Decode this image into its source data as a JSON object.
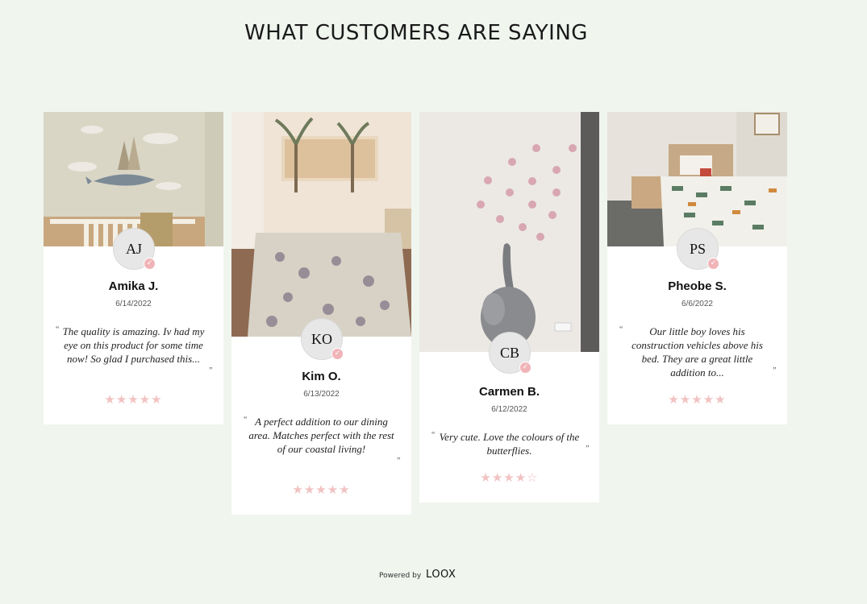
{
  "heading": "WHAT CUSTOMERS ARE SAYING",
  "reviews": [
    {
      "initials": "AJ",
      "name": "Amika J.",
      "date": "6/14/2022",
      "text": "The quality is amazing. Iv had my eye on this product for some time now! So glad I purchased this...",
      "rating": 5,
      "stars": "★★★★★"
    },
    {
      "initials": "KO",
      "name": "Kim O.",
      "date": "6/13/2022",
      "text": "A perfect addition to our dining area. Matches perfect with the rest of our coastal living!",
      "rating": 5,
      "stars": "★★★★★"
    },
    {
      "initials": "CB",
      "name": "Carmen B.",
      "date": "6/12/2022",
      "text": "Very cute. Love the colours of the butterflies.",
      "rating": 4,
      "stars": "★★★★☆"
    },
    {
      "initials": "PS",
      "name": "Pheobe S.",
      "date": "6/6/2022",
      "text": "Our little boy loves his construction vehicles above his bed. They are a great little addition to...",
      "rating": 5,
      "stars": "★★★★★"
    }
  ],
  "quote_open": "“",
  "quote_close": "”",
  "verified_icon": "check-icon",
  "footer": {
    "powered_by": "Powered by",
    "brand": "LOOX"
  },
  "colors": {
    "background": "#f0f5ee",
    "star": "#f2c2c2",
    "badge": "#f0b4b8"
  }
}
